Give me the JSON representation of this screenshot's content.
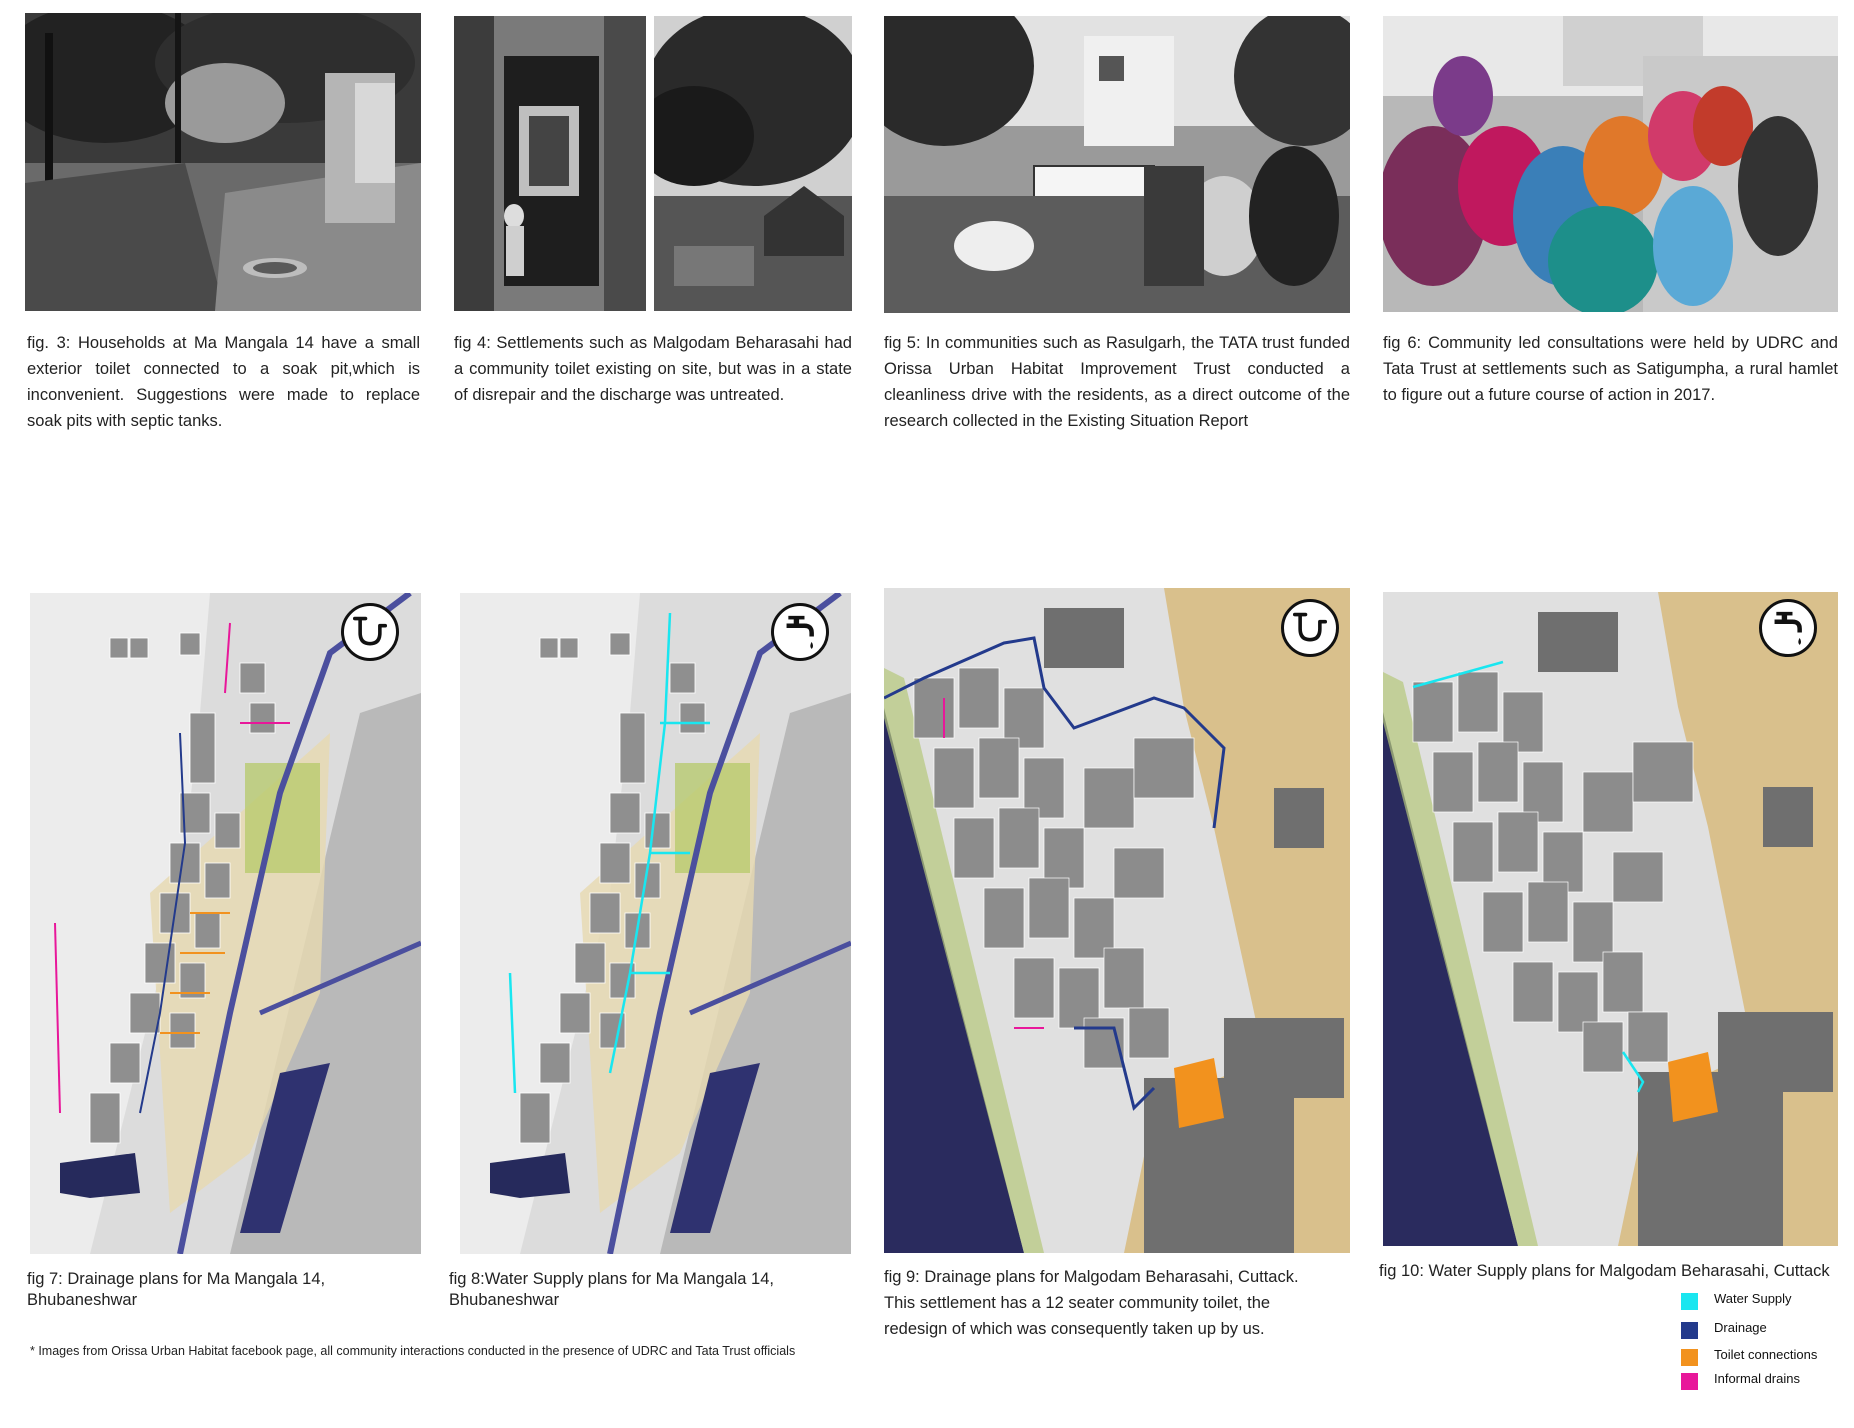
{
  "figures_top": [
    {
      "id": "fig3",
      "caption": "fig. 3: Households at  Ma Mangala 14 have a small exterior toilet connected to a soak pit,which is inconvenient. Suggestions were made to replace soak pits with septic tanks.",
      "photo": "Outdoor settlement area with trees, stacked materials and a soak pit cover (black and white)"
    },
    {
      "id": "fig4",
      "caption": "fig 4: Settlements such as Malgodam Beharasahi had a community toilet  existing on site, but was in a state of disrepair and the discharge was untreated.",
      "photo": "Dilapidated toilet doorway with child; tree and shed (black and white)"
    },
    {
      "id": "fig5",
      "caption": "fig 5: In communities such as Rasulgarh, the TATA trust funded Orissa Urban Habitat Improvement Trust conducted a cleanliness drive with the residents, as a direct outcome of the research collected in the Existing Situation Report",
      "photo": "Residents holding a banner in a lane during cleanliness drive (black and white)"
    },
    {
      "id": "fig6",
      "caption": "fig 6: Community led consultations were held by UDRC and Tata Trust at settlements such as Satigumpha, a rural hamlet to figure out a future course of action in 2017.",
      "photo": "Women seated in a circle during community consultation (color)"
    }
  ],
  "figures_bottom": [
    {
      "id": "fig7",
      "caption": "fig 7: Drainage plans for Ma Mangala 14, Bhubaneshwar",
      "icon": "drain-pipe-icon"
    },
    {
      "id": "fig8",
      "caption": "fig 8:Water Supply plans for Ma Mangala 14, Bhubaneshwar",
      "icon": "water-tap-icon"
    },
    {
      "id": "fig9",
      "caption": "fig 9: Drainage plans for Malgodam Beharasahi, Cuttack. This settlement has a 12 seater community toilet, the redesign of which was consequently taken up by us.",
      "icon": "drain-pipe-icon"
    },
    {
      "id": "fig10",
      "caption": "fig 10: Water Supply plans for Malgodam Beharasahi, Cuttack",
      "icon": "water-tap-icon"
    }
  ],
  "legend": [
    {
      "label": "Water Supply",
      "color": "#19e6f0"
    },
    {
      "label": "Drainage",
      "color": "#233a8c"
    },
    {
      "label": "Toilet connections",
      "color": "#f2921e"
    },
    {
      "label": "Informal drains",
      "color": "#e8179a"
    }
  ],
  "footnote": "* Images from Orissa Urban Habitat facebook page, all community interactions conducted in the presence of UDRC and Tata Trust officials"
}
